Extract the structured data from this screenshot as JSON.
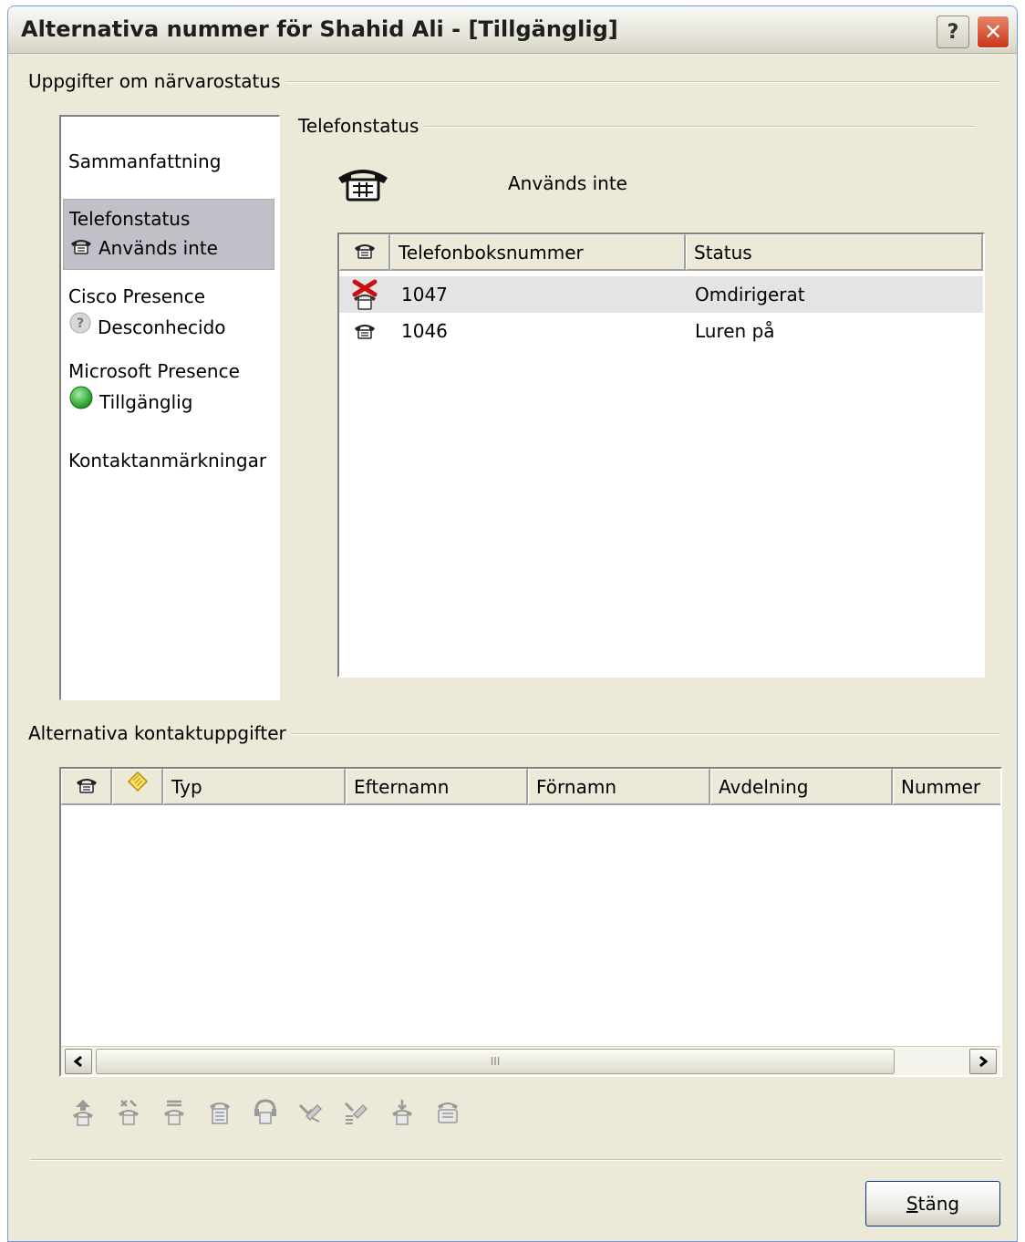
{
  "window": {
    "title": "Alternativa nummer för Shahid Ali - [Tillgänglig]",
    "help_glyph": "?",
    "close_glyph": "✕"
  },
  "presence": {
    "group_label": "Uppgifter om närvarostatus",
    "nav": {
      "summary": "Sammanfattning",
      "phone_status_title": "Telefonstatus",
      "phone_status_value": "Används inte",
      "cisco_title": "Cisco Presence",
      "cisco_value": "Desconhecido",
      "microsoft_title": "Microsoft Presence",
      "microsoft_value": "Tillgänglig",
      "notes": "Kontaktanmärkningar"
    },
    "phone_status": {
      "group_label": "Telefonstatus",
      "current_status": "Används inte",
      "columns": [
        "",
        "Telefonboksnummer",
        "Status"
      ],
      "rows": [
        {
          "icon": "phone-forwarded-icon",
          "number": "1047",
          "status": "Omdirigerat"
        },
        {
          "icon": "phone-icon",
          "number": "1046",
          "status": "Luren på"
        }
      ]
    }
  },
  "alternative": {
    "group_label": "Alternativa kontaktuppgifter",
    "columns": [
      "",
      "",
      "Typ",
      "Efternamn",
      "Förnamn",
      "Avdelning",
      "Nummer"
    ],
    "scroll_grip": "III"
  },
  "toolbar_icons": [
    "phone-up-icon",
    "phone-transfer-icon",
    "phone-conference-icon",
    "phone-hold-icon",
    "phone-headset-icon",
    "phone-forward-icon",
    "phone-redirect-icon",
    "phone-pickup-icon",
    "phone-speaker-icon"
  ],
  "footer": {
    "close_button": "Stäng",
    "close_accesskey": "S",
    "close_rest": "täng"
  },
  "colors": {
    "dialog_bg": "#ece9d8",
    "close_red": "#c9381a",
    "presence_green": "#2e9e2e",
    "forward_red": "#cc1010"
  }
}
